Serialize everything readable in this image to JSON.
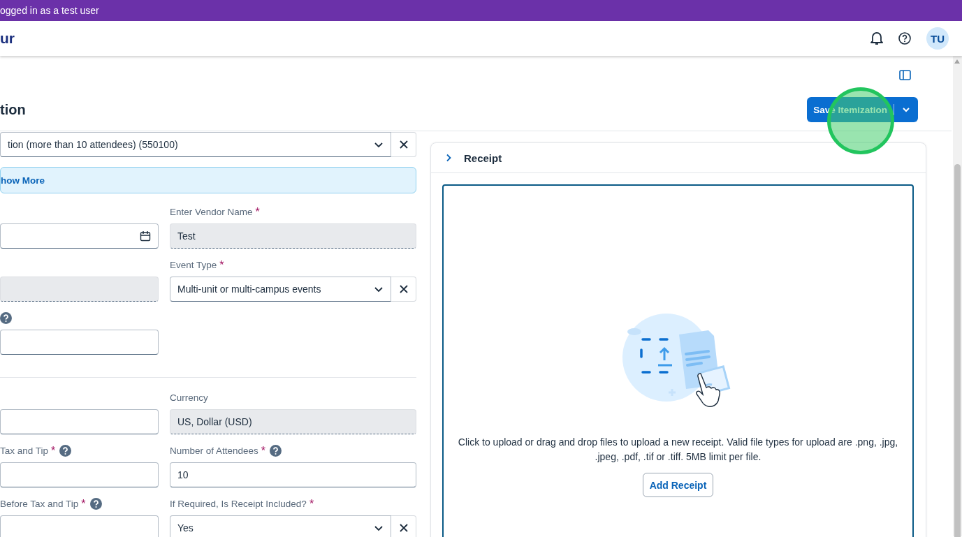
{
  "banner": {
    "text": "ogged in as a test user"
  },
  "header": {
    "logo": "ur",
    "avatar": "TU"
  },
  "page": {
    "title": "tion",
    "save_button": "Save Itemization"
  },
  "expense_type": {
    "kind": "select",
    "value": "tion (more than 10 attendees) (550100)"
  },
  "info_bar": {
    "link": "how More"
  },
  "sections": [
    {
      "rows": [
        [
          {
            "kind": "date"
          },
          {
            "kind": "readonly",
            "label": "Enter Vendor Name",
            "mark": "*",
            "value": "Test"
          }
        ],
        [
          {
            "kind": "readonly"
          },
          {
            "kind": "select",
            "label": "Event Type",
            "mark": "*",
            "value": "Multi-unit or multi-campus events"
          }
        ],
        [
          {
            "kind": "text",
            "help": true
          }
        ]
      ]
    },
    {
      "rows": [
        [
          {
            "kind": "text"
          },
          {
            "kind": "readonly",
            "label": "Currency",
            "value": "US, Dollar (USD)"
          }
        ],
        [
          {
            "kind": "text",
            "label": "Tax and Tip",
            "mark": "*",
            "help": true
          },
          {
            "kind": "text",
            "label": "Number of Attendees",
            "mark": "*",
            "help": true,
            "value": "10"
          }
        ],
        [
          {
            "kind": "text",
            "label": "Before Tax and Tip",
            "mark": "*",
            "help": true
          },
          {
            "kind": "select",
            "label": "If Required, Is Receipt Included?",
            "mark": "*",
            "value": "Yes"
          }
        ]
      ]
    }
  ],
  "receipt": {
    "title": "Receipt",
    "instructions": "Click to upload or drag and drop files to upload a new receipt. Valid file types for upload are .png, .jpg, .jpeg, .pdf, .tif or .tiff. 5MB limit per file.",
    "button": "Add Receipt"
  }
}
